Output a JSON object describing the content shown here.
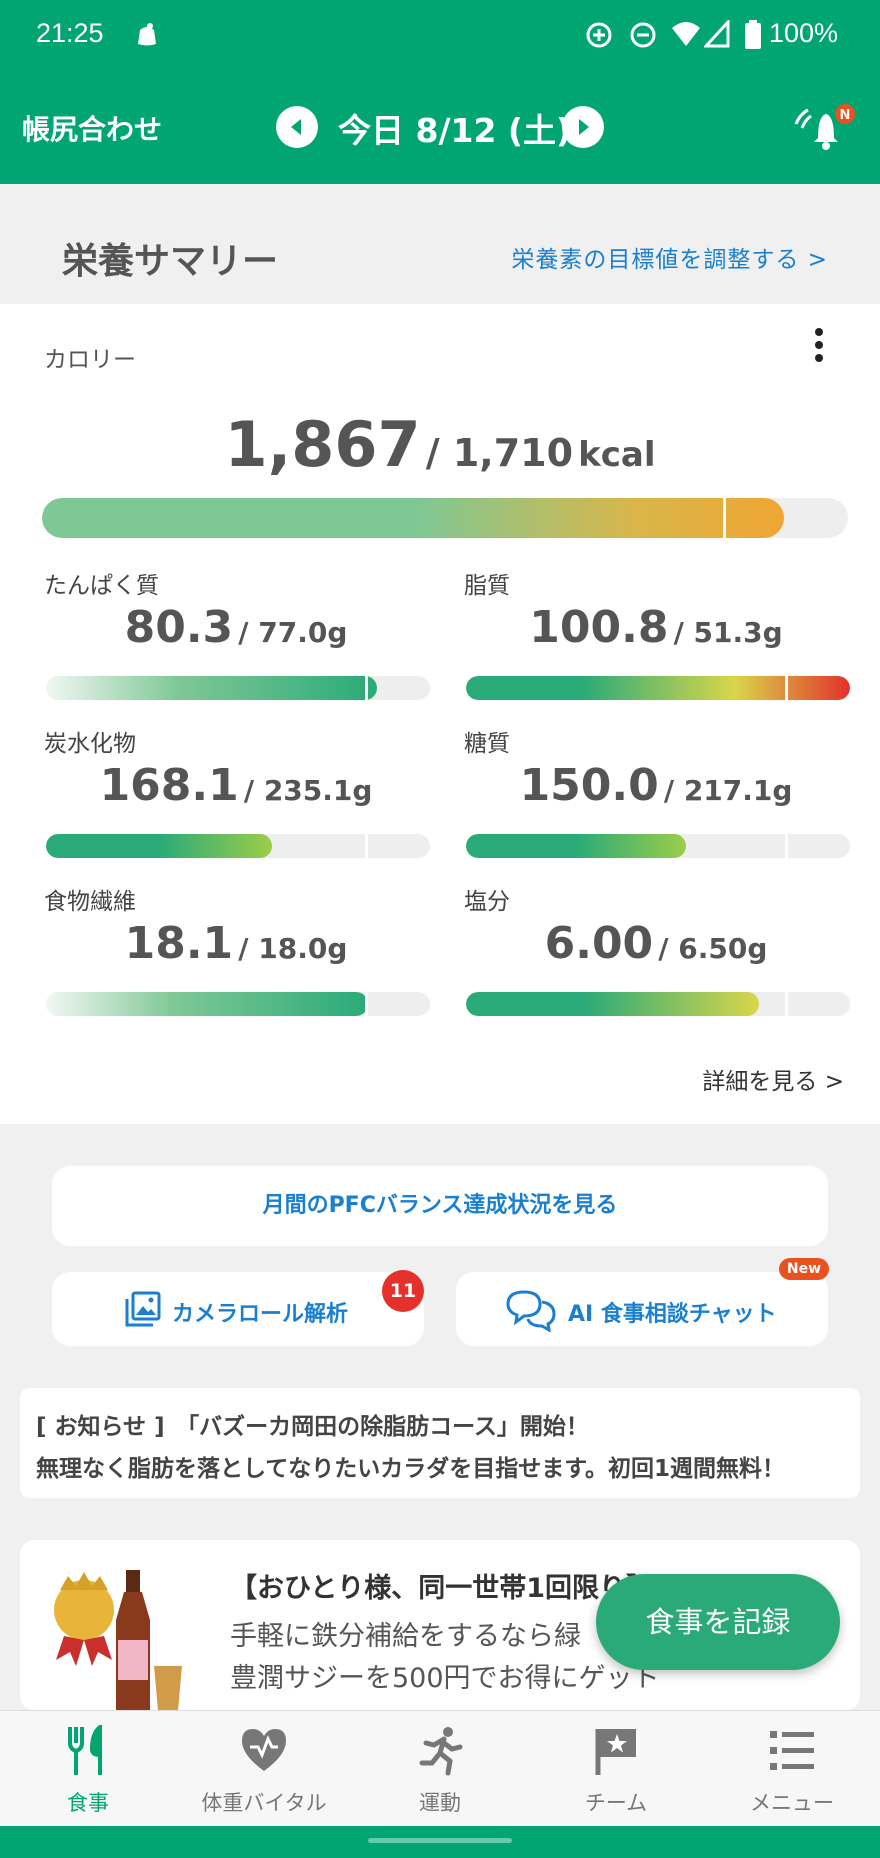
{
  "status_bar": {
    "time": "21:25",
    "battery": "100%"
  },
  "header": {
    "ledger_label": "帳尻合わせ",
    "date_label": "今日 8/12 (土)",
    "notification_badge": "N"
  },
  "summary": {
    "title": "栄養サマリー",
    "adjust_link": "栄養素の目標値を調整する >"
  },
  "calorie": {
    "label": "カロリー",
    "value": "1,867",
    "target": "/ 1,710",
    "unit": "kcal",
    "progress_fraction": 1.09
  },
  "nutrients": [
    {
      "label": "たんぱく質",
      "value": "80.3",
      "target": "/ 77.0g",
      "progress_fraction": 1.04
    },
    {
      "label": "脂質",
      "value": "100.8",
      "target": "/ 51.3g",
      "progress_fraction": 1.96
    },
    {
      "label": "炭水化物",
      "value": "168.1",
      "target": "/ 235.1g",
      "progress_fraction": 0.71
    },
    {
      "label": "糖質",
      "value": "150.0",
      "target": "/ 217.1g",
      "progress_fraction": 0.69
    },
    {
      "label": "食物繊維",
      "value": "18.1",
      "target": "/ 18.0g",
      "progress_fraction": 1.01
    },
    {
      "label": "塩分",
      "value": "6.00",
      "target": "/ 6.50g",
      "progress_fraction": 0.92
    }
  ],
  "details_link": "詳細を見る >",
  "pfc_button": "月間のPFCバランス達成状況を見る",
  "camera_button": {
    "label": "カメラロール解析",
    "badge": "11"
  },
  "ai_chat_button": {
    "label": "AI 食事相談チャット",
    "badge": "New"
  },
  "notice": {
    "line1": "[ お知らせ ]　「バズーカ岡田の除脂肪コース」開始！",
    "line2": "無理なく脂肪を落としてなりたいカラダを目指せます。初回1週間無料！"
  },
  "promo": {
    "line1": "【おひとり様、同一世帯1回限り】",
    "line2": "手軽に鉄分補給をするなら緑",
    "line3": "豊潤サジーを500円でお得にゲット"
  },
  "fab_label": "食事を記録",
  "bottom_nav": [
    {
      "label": "食事",
      "icon": "fork-knife-icon",
      "active": true
    },
    {
      "label": "体重バイタル",
      "icon": "heart-vital-icon",
      "active": false
    },
    {
      "label": "運動",
      "icon": "running-icon",
      "active": false
    },
    {
      "label": "チーム",
      "icon": "flag-icon",
      "active": false
    },
    {
      "label": "メニュー",
      "icon": "menu-list-icon",
      "active": false
    }
  ],
  "colors": {
    "primary": "#00a572",
    "link": "#1a7fd0",
    "alert": "#e4312b"
  }
}
